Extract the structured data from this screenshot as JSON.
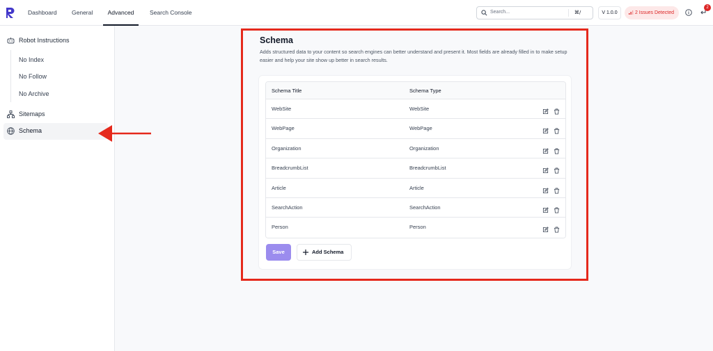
{
  "nav": {
    "tabs": [
      {
        "label": "Dashboard"
      },
      {
        "label": "General"
      },
      {
        "label": "Advanced"
      },
      {
        "label": "Search Console"
      }
    ],
    "active_tab": "Advanced",
    "search_placeholder": "Search...",
    "search_shortcut": "⌘/",
    "version": "V 1.0.0",
    "issues_label": "2 Issues Detected",
    "notification_count": "2",
    "accent_color": "#7c6ce6",
    "issues_color": "#dc2626"
  },
  "sidebar": {
    "robot": "Robot Instructions",
    "robot_items": [
      "No Index",
      "No Follow",
      "No Archive"
    ],
    "sitemaps": "Sitemaps",
    "schema": "Schema",
    "active_item": "Schema"
  },
  "main": {
    "title": "Schema",
    "description": "Adds structured data to your content so search engines can better understand and present it. Most fields are already filled in to make setup easier and help your site show up better in search results.",
    "table": {
      "headers": [
        "Schema Title",
        "Schema Type"
      ],
      "rows": [
        {
          "title": "WebSite",
          "type": "WebSite"
        },
        {
          "title": "WebPage",
          "type": "WebPage"
        },
        {
          "title": "Organization",
          "type": "Organization"
        },
        {
          "title": "BreadcrumbList",
          "type": "BreadcrumbList"
        },
        {
          "title": "Article",
          "type": "Article"
        },
        {
          "title": "SearchAction",
          "type": "SearchAction"
        },
        {
          "title": "Person",
          "type": "Person"
        }
      ]
    },
    "save_label": "Save",
    "add_label": "Add Schema"
  },
  "annotation": {
    "highlight_color": "#e5291c"
  }
}
